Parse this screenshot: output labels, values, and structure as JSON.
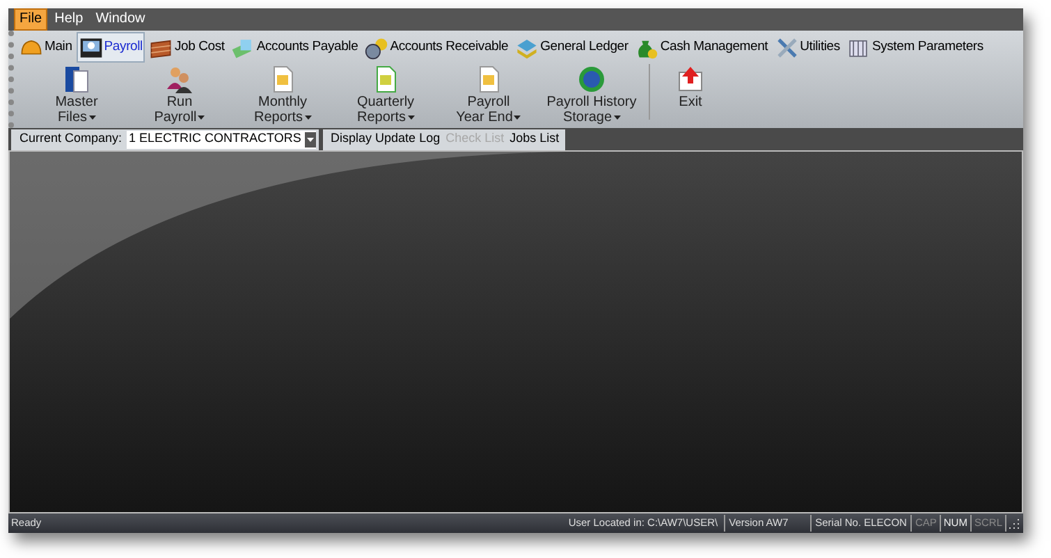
{
  "menu": [
    {
      "label": "File",
      "selected": true
    },
    {
      "label": "Help",
      "selected": false
    },
    {
      "label": "Window",
      "selected": false
    }
  ],
  "tabs": [
    {
      "label": "Main",
      "selected": false
    },
    {
      "label": "Payroll",
      "selected": true
    },
    {
      "label": "Job Cost",
      "selected": false
    },
    {
      "label": "Accounts Payable",
      "selected": false
    },
    {
      "label": "Accounts Receivable",
      "selected": false
    },
    {
      "label": "General Ledger",
      "selected": false
    },
    {
      "label": "Cash Management",
      "selected": false
    },
    {
      "label": "Utilities",
      "selected": false
    },
    {
      "label": "System Parameters",
      "selected": false
    }
  ],
  "ribbon": [
    {
      "line1": "Master",
      "line2": "Files",
      "dropdown": true
    },
    {
      "line1": "Run",
      "line2": "Payroll",
      "dropdown": true
    },
    {
      "line1": "Monthly",
      "line2": "Reports",
      "dropdown": true
    },
    {
      "line1": "Quarterly",
      "line2": "Reports",
      "dropdown": true
    },
    {
      "line1": "Payroll",
      "line2": "Year End",
      "dropdown": true
    },
    {
      "line1": "Payroll History",
      "line2": "Storage",
      "dropdown": true
    },
    {
      "line1": "Exit",
      "dropdown": false
    }
  ],
  "company": {
    "label": "Current Company:",
    "value": "1 ELECTRIC CONTRACTORS"
  },
  "toolbar": [
    {
      "label": "Display Update Log",
      "disabled": false
    },
    {
      "label": "Check List",
      "disabled": true
    },
    {
      "label": "Jobs List",
      "disabled": false
    }
  ],
  "status_bar": {
    "message": "Ready",
    "user": "User Located in: C:\\AW7\\USER\\",
    "version": "Version AW7",
    "serial": "Serial No. ELECON",
    "keys": [
      {
        "label": "CAP",
        "on": false
      },
      {
        "label": "NUM",
        "on": true
      },
      {
        "label": "SCRL",
        "on": false
      }
    ]
  }
}
